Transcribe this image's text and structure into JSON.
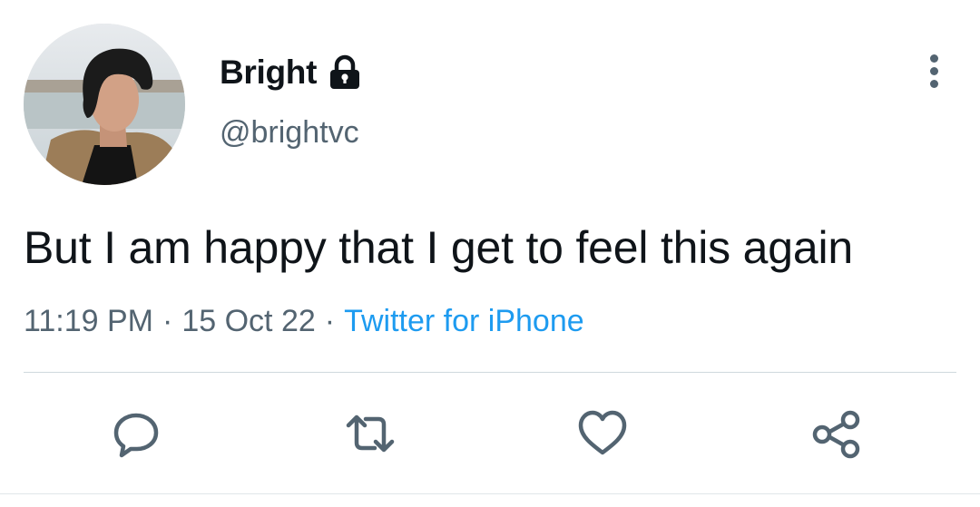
{
  "tweet": {
    "author": {
      "display_name": "Bright",
      "handle": "@brightvc",
      "protected_icon": "lock-icon",
      "avatar": "profile-photo"
    },
    "text": "But I am happy that I get to feel this again",
    "meta": {
      "time": "11:19 PM",
      "separator": "·",
      "date": "15 Oct 22",
      "source": "Twitter for iPhone"
    }
  },
  "actions": [
    {
      "name": "reply",
      "icon": "reply-icon"
    },
    {
      "name": "retweet",
      "icon": "retweet-icon"
    },
    {
      "name": "like",
      "icon": "heart-icon"
    },
    {
      "name": "share",
      "icon": "share-icon"
    }
  ],
  "more_icon": "more-vertical-icon",
  "colors": {
    "text": "#0f1419",
    "secondary": "#536471",
    "link": "#1d9bf0",
    "divider": "#cfd9de"
  }
}
